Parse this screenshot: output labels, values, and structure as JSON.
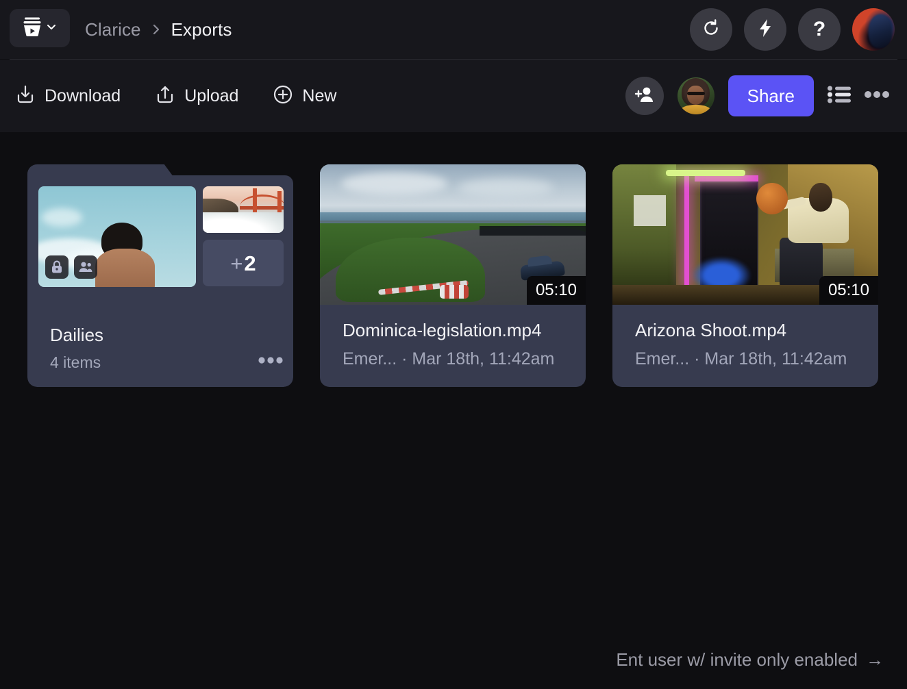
{
  "header": {
    "logo_icon": "frameio-logo-icon",
    "logo_dropdown_icon": "chevron-down-icon",
    "breadcrumb": {
      "root": "Clarice",
      "separator_icon": "chevron-right-icon",
      "current": "Exports"
    },
    "actions": [
      {
        "name": "refresh-button",
        "icon": "refresh-icon"
      },
      {
        "name": "lightning-button",
        "icon": "lightning-bolt-icon"
      },
      {
        "name": "help-button",
        "icon": "question-mark-icon",
        "label": "?"
      }
    ],
    "avatar": {
      "name": "user-avatar",
      "icon": "avatar"
    }
  },
  "toolbar": {
    "download_label": "Download",
    "download_icon": "download-icon",
    "upload_label": "Upload",
    "upload_icon": "upload-icon",
    "new_label": "New",
    "new_icon": "plus-circle-icon",
    "add_person_icon": "add-person-icon",
    "collaborator_avatar": "collaborator-avatar",
    "share_label": "Share",
    "list_view_icon": "list-view-icon",
    "more_icon": "more-horizontal-icon"
  },
  "colors": {
    "accent": "#5B53F5",
    "header_bg": "#17171C",
    "content_bg": "#0E0E11",
    "card_bg": "#373B4F",
    "text_primary": "#F2F2F5",
    "text_muted": "#A3A7BA"
  },
  "grid": {
    "folder": {
      "name": "Dailies",
      "item_count": "4 items",
      "overflow_plus": "+",
      "overflow_count": "2",
      "lock_icon": "lock-icon",
      "people_icon": "people-icon",
      "more_icon": "more-horizontal-icon",
      "thumbnails": [
        "sky-person-thumbnail",
        "golden-gate-bridge-thumbnail"
      ]
    },
    "assets": [
      {
        "title": "Dominica-legislation.mp4",
        "meta": "Emer... · Mar 18th, 11:42am",
        "duration": "05:10",
        "thumbnail": "racetrack-car-thumbnail"
      },
      {
        "title": "Arizona Shoot.mp4",
        "meta": "Emer... · Mar 18th, 11:42am",
        "duration": "05:10",
        "thumbnail": "neon-basketball-thumbnail"
      }
    ]
  },
  "footer": {
    "hint": "Ent user w/ invite only enabled",
    "arrow": "→"
  }
}
